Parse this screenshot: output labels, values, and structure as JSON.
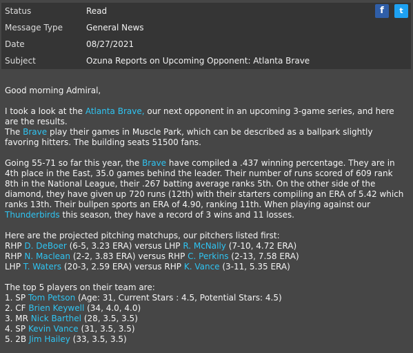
{
  "header": {
    "rows": [
      {
        "label": "Status",
        "value": "Read"
      },
      {
        "label": "Message Type",
        "value": "General News"
      },
      {
        "label": "Date",
        "value": "08/27/2021"
      },
      {
        "label": "Subject",
        "value": "Ozuna Reports on Upcoming Opponent: Atlanta Brave"
      }
    ],
    "facebook_icon": "f",
    "twitter_icon": "t"
  },
  "body": {
    "greeting": "Good morning Admiral,",
    "p1_a": "I took a look at the ",
    "p1_link": "Atlanta Brave,",
    "p1_b": " our next opponent in an upcoming 3-game series, and here are the results.",
    "p2_a": "The ",
    "p2_link": "Brave",
    "p2_b": " play their games in Muscle Park, which can be described as a ballpark slightly favoring hitters. The building seats 51500 fans.",
    "p3_a": "Going 55-71 so far this year, the ",
    "p3_link": "Brave",
    "p3_b": " have compiled a .437 winning percentage. They are in 4th place in the East, 35.0 games behind the leader. Their number of runs scored of 609 rank 8th in the National League, their .267 batting average ranks 5th. On the other side of the diamond, they have given up 720 runs (12th) with their starters compiling an ERA of 5.42 which ranks 13th. Their bullpen sports an ERA of 4.90, ranking 11th. When playing against our ",
    "p3_link2": "Thunderbirds",
    "p3_c": " this season, they have a record of 3 wins and 11 losses.",
    "matchups_intro": "Here are the projected pitching matchups, our pitchers listed first:",
    "matchups": [
      {
        "h1": "RHP ",
        "p1": "D. DeBoer",
        "s1": " (6-5, 3.23 ERA) versus LHP ",
        "p2": "R. McNally",
        "s2": " (7-10, 4.72 ERA)"
      },
      {
        "h1": "RHP ",
        "p1": "N. Maclean",
        "s1": " (2-2, 3.83 ERA) versus RHP ",
        "p2": "C. Perkins",
        "s2": " (2-13, 7.58 ERA)"
      },
      {
        "h1": "LHP ",
        "p1": "T. Waters",
        "s1": " (20-3, 2.59 ERA) versus RHP ",
        "p2": "K. Vance",
        "s2": " (3-11, 5.35 ERA)"
      }
    ],
    "top_intro": "The top 5 players on their team are:",
    "top": [
      {
        "pre": "1. SP ",
        "name": "Tom Petson",
        "post": " (Age: 31, Current Stars : 4.5, Potential Stars: 4.5)"
      },
      {
        "pre": "2. CF ",
        "name": "Brien Keywell",
        "post": " (34, 4.0, 4.0)"
      },
      {
        "pre": "3. MR ",
        "name": "Nick Barthel",
        "post": " (28, 3.5, 3.5)"
      },
      {
        "pre": "4. SP ",
        "name": "Kevin Vance",
        "post": " (31, 3.5, 3.5)"
      },
      {
        "pre": "5. 2B ",
        "name": "Jim Hailey",
        "post": " (33, 3.5, 3.5)"
      }
    ]
  }
}
